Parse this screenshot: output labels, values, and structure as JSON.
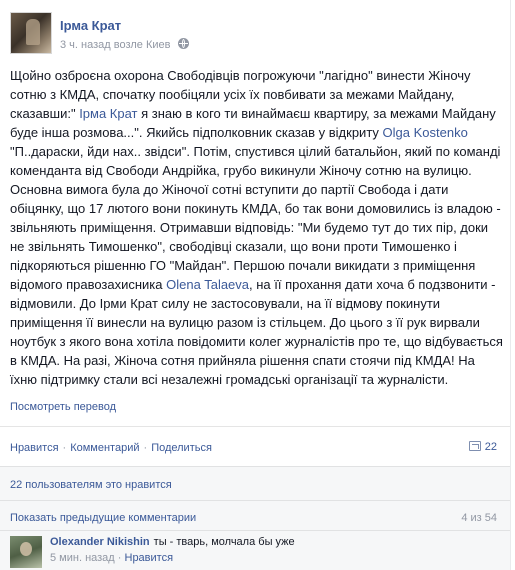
{
  "post": {
    "author": "Ірма Крат",
    "time": "3 ч. назад",
    "location": "возле Киев",
    "text_parts": [
      {
        "t": "Щойно озброєна охорона Свободівців погрожуючи \"лагідно\" винести Жіночу сотню з КМДА, спочатку пообіцяли усіх їх повбивати за межами Майдану, сказавши:\" "
      },
      {
        "t": "Ірма Крат",
        "mention": true
      },
      {
        "t": " я знаю в кого ти винаймаєш квартиру, за межами Майдану буде інша розмова...\". Якийсь підполковник сказав у відкриту "
      },
      {
        "t": "Olga Kostenko",
        "mention": true
      },
      {
        "t": " \"П..дараски, йди нах.. звідси\". Потім, спустився цілий батальйон, який по команді коменданта від Свободи Андрійка, грубо викинули Жіночу сотню на вулицю. Основна вимога була до Жіночої сотні вступити до партії Свобода і дати обіцянку, що 17 лютого вони покинуть КМДА, бо так вони домовились із владою - звільняють приміщення. Отримавши відповідь: \"Ми будемо тут до тих пір, доки не звільнять Тимошенко\", свободівці сказали, що вони проти Тимошенко і підкоряються рішенню ГО \"Майдан\". Першою почали викидати з приміщення відомого правозахисника "
      },
      {
        "t": "Olena Talaeva",
        "mention": true
      },
      {
        "t": ", на її прохання дати хоча б подзвонити - відмовили. До Ірми Крат силу не застосовували, на її відмову покинути приміщення її винесли на вулицю разом із стільцем. До цього з її рук вирвали ноутбук з якого вона хотіла повідомити колег журналістів про те, що відбувається в КМДА. На разі, Жіноча сотня прийняла рішення спати стоячи під КМДА! На їхню підтримку стали всі незалежні громадські організації та журналісти."
      }
    ],
    "translate_label": "Посмотреть перевод"
  },
  "actions": {
    "like": "Нравится",
    "comment": "Комментарий",
    "share": "Поделиться",
    "share_count": "22"
  },
  "likes_text": "22 пользователям это нравится",
  "comments": {
    "show_previous": "Показать предыдущие комментарии",
    "pager": "4 из 54",
    "items": [
      {
        "author": "Olexander Nikishin",
        "text": "ты - тварь, молчала бы уже",
        "time": "5 мин. назад",
        "like": "Нравится"
      }
    ]
  },
  "colors": {
    "link": "#3b5998",
    "text": "#141823",
    "muted": "#9197a3",
    "ufi_bg": "#f6f7f8"
  },
  "icons": [
    "globe-icon",
    "share-icon"
  ]
}
